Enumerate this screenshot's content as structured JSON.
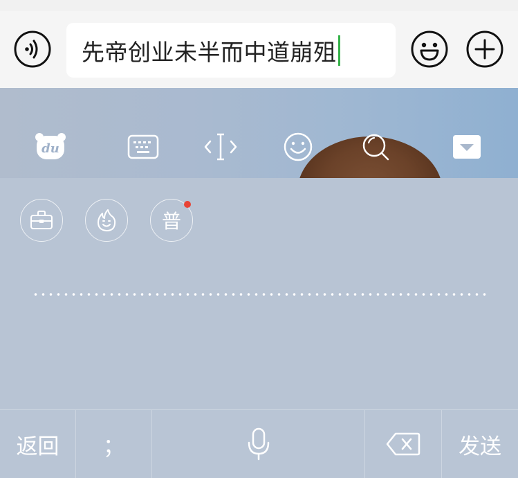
{
  "input": {
    "text": "先帝创业未半而中道崩殂"
  },
  "keyboard": {
    "toolbar": {
      "icons": [
        "du-logo-icon",
        "keyboard-icon",
        "cursor-move-icon",
        "emoji-smile-icon",
        "search-icon",
        "collapse-icon"
      ]
    },
    "tools": {
      "pu_label": "普"
    },
    "bottom": {
      "back_label": "返回",
      "semicolon_label": "；",
      "send_label": "发送"
    }
  },
  "colors": {
    "caret": "#37b34a",
    "notification_dot": "#e84335"
  }
}
